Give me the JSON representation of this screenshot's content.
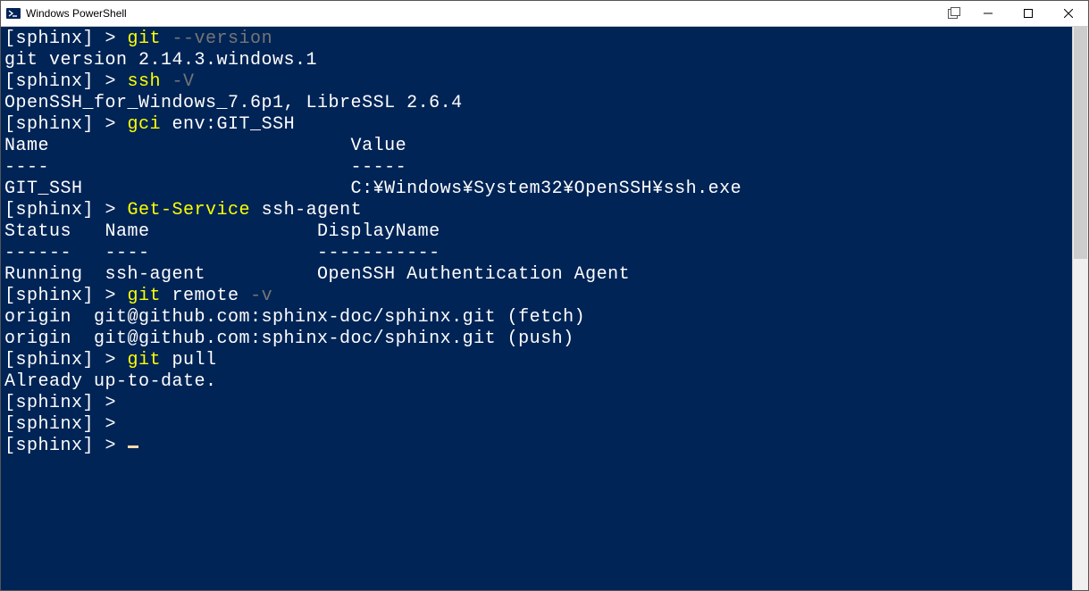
{
  "window": {
    "title": "Windows PowerShell"
  },
  "term": {
    "lines": [
      [
        {
          "c": "w",
          "t": "[sphinx] > "
        },
        {
          "c": "y",
          "t": "git "
        },
        {
          "c": "g",
          "t": "--version"
        }
      ],
      [
        {
          "c": "w",
          "t": "git version 2.14.3.windows.1"
        }
      ],
      [
        {
          "c": "w",
          "t": "[sphinx] > "
        },
        {
          "c": "y",
          "t": "ssh "
        },
        {
          "c": "g",
          "t": "-V"
        }
      ],
      [
        {
          "c": "w",
          "t": "OpenSSH_for_Windows_7.6p1, LibreSSL 2.6.4"
        }
      ],
      [
        {
          "c": "w",
          "t": "[sphinx] > "
        },
        {
          "c": "y",
          "t": "gci "
        },
        {
          "c": "w",
          "t": "env:GIT_SSH"
        }
      ],
      [
        {
          "c": "w",
          "t": ""
        }
      ],
      [
        {
          "c": "w",
          "t": "Name                           Value"
        }
      ],
      [
        {
          "c": "w",
          "t": "----                           -----"
        }
      ],
      [
        {
          "c": "w",
          "t": "GIT_SSH                        C:¥Windows¥System32¥OpenSSH¥ssh.exe"
        }
      ],
      [
        {
          "c": "w",
          "t": ""
        }
      ],
      [
        {
          "c": "w",
          "t": ""
        }
      ],
      [
        {
          "c": "w",
          "t": "[sphinx] > "
        },
        {
          "c": "y",
          "t": "Get-Service "
        },
        {
          "c": "w",
          "t": "ssh-agent"
        }
      ],
      [
        {
          "c": "w",
          "t": ""
        }
      ],
      [
        {
          "c": "w",
          "t": "Status   Name               DisplayName"
        }
      ],
      [
        {
          "c": "w",
          "t": "------   ----               -----------"
        }
      ],
      [
        {
          "c": "w",
          "t": "Running  ssh-agent          OpenSSH Authentication Agent"
        }
      ],
      [
        {
          "c": "w",
          "t": ""
        }
      ],
      [
        {
          "c": "w",
          "t": ""
        }
      ],
      [
        {
          "c": "w",
          "t": "[sphinx] > "
        },
        {
          "c": "y",
          "t": "git "
        },
        {
          "c": "w",
          "t": "remote "
        },
        {
          "c": "g",
          "t": "-v"
        }
      ],
      [
        {
          "c": "w",
          "t": "origin  git@github.com:sphinx-doc/sphinx.git (fetch)"
        }
      ],
      [
        {
          "c": "w",
          "t": "origin  git@github.com:sphinx-doc/sphinx.git (push)"
        }
      ],
      [
        {
          "c": "w",
          "t": "[sphinx] > "
        },
        {
          "c": "y",
          "t": "git "
        },
        {
          "c": "w",
          "t": "pull"
        }
      ],
      [
        {
          "c": "w",
          "t": "Already up-to-date."
        }
      ],
      [
        {
          "c": "w",
          "t": "[sphinx] >"
        }
      ],
      [
        {
          "c": "w",
          "t": "[sphinx] >"
        }
      ],
      [
        {
          "c": "w",
          "t": "[sphinx] > "
        },
        {
          "c": "cursor",
          "t": ""
        }
      ]
    ]
  }
}
